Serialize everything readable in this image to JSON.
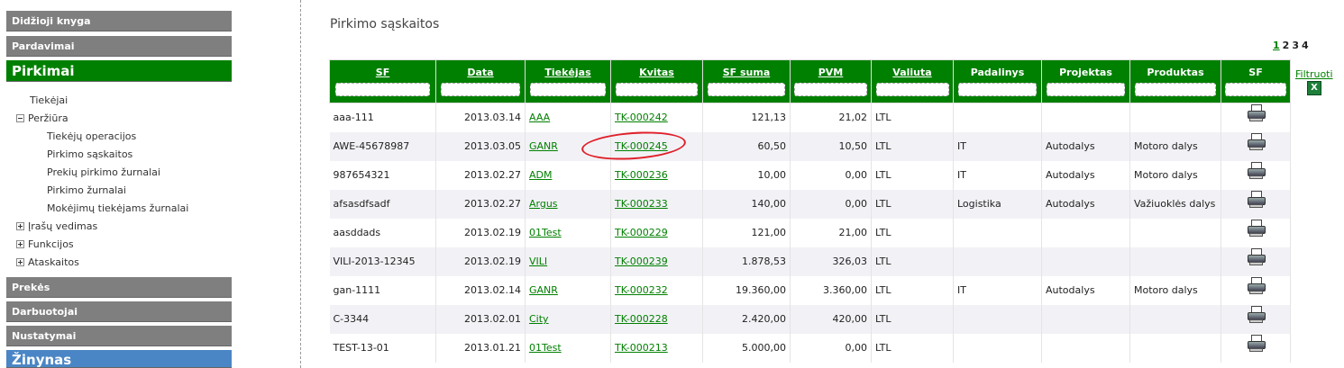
{
  "sidebar": {
    "menu": [
      {
        "label": "Didžioji knyga"
      },
      {
        "label": "Pardavimai"
      },
      {
        "label": "Pirkimai"
      },
      {
        "label": "Prekės"
      },
      {
        "label": "Darbuotojai"
      },
      {
        "label": "Nustatymai"
      },
      {
        "label": "Žinynas"
      }
    ],
    "tree": [
      {
        "label": "Tiekėjai"
      },
      {
        "label": "Peržiūra"
      },
      {
        "label": "Tiekėjų operacijos"
      },
      {
        "label": "Pirkimo sąskaitos"
      },
      {
        "label": "Prekių pirkimo žurnalai"
      },
      {
        "label": "Pirkimo žurnalai"
      },
      {
        "label": "Mokėjimų tiekėjams žurnalai"
      },
      {
        "label": "Įrašų vedimas"
      },
      {
        "label": "Funkcijos"
      },
      {
        "label": "Ataskaitos"
      }
    ]
  },
  "main": {
    "title": "Pirkimo sąskaitos",
    "pager": [
      "1",
      "2",
      "3",
      "4"
    ],
    "filter_link": "Filtruoti",
    "columns": [
      "SF",
      "Data",
      "Tiekėjas",
      "Kvitas",
      "SF suma",
      "PVM",
      "Valiuta",
      "Padalinys",
      "Projektas",
      "Produktas",
      "SF"
    ],
    "rows": [
      {
        "sf": "aaa-111",
        "data": "2013.03.14",
        "tiekejas": "AAA",
        "kvitas": "TK-000242",
        "suma": "121,13",
        "pvm": "21,02",
        "valiuta": "LTL",
        "padalinys": "",
        "projektas": "",
        "produktas": ""
      },
      {
        "sf": "AWE-45678987",
        "data": "2013.03.05",
        "tiekejas": "GANR",
        "kvitas": "TK-000245",
        "suma": "60,50",
        "pvm": "10,50",
        "valiuta": "LTL",
        "padalinys": "IT",
        "projektas": "Autodalys",
        "produktas": "Motoro dalys"
      },
      {
        "sf": "987654321",
        "data": "2013.02.27",
        "tiekejas": "ADM",
        "kvitas": "TK-000236",
        "suma": "10,00",
        "pvm": "0,00",
        "valiuta": "LTL",
        "padalinys": "IT",
        "projektas": "Autodalys",
        "produktas": "Motoro dalys"
      },
      {
        "sf": "afsasdfsadf",
        "data": "2013.02.27",
        "tiekejas": "Argus",
        "kvitas": "TK-000233",
        "suma": "140,00",
        "pvm": "0,00",
        "valiuta": "LTL",
        "padalinys": "Logistika",
        "projektas": "Autodalys",
        "produktas": "Važiuoklės dalys"
      },
      {
        "sf": "aasddads",
        "data": "2013.02.19",
        "tiekejas": "01Test",
        "kvitas": "TK-000229",
        "suma": "121,00",
        "pvm": "21,00",
        "valiuta": "LTL",
        "padalinys": "",
        "projektas": "",
        "produktas": ""
      },
      {
        "sf": "VILI-2013-12345",
        "data": "2013.02.19",
        "tiekejas": "VILI",
        "kvitas": "TK-000239",
        "suma": "1.878,53",
        "pvm": "326,03",
        "valiuta": "LTL",
        "padalinys": "",
        "projektas": "",
        "produktas": ""
      },
      {
        "sf": "gan-1111",
        "data": "2013.02.14",
        "tiekejas": "GANR",
        "kvitas": "TK-000232",
        "suma": "19.360,00",
        "pvm": "3.360,00",
        "valiuta": "LTL",
        "padalinys": "IT",
        "projektas": "Autodalys",
        "produktas": "Motoro dalys"
      },
      {
        "sf": "C-3344",
        "data": "2013.02.01",
        "tiekejas": "City",
        "kvitas": "TK-000228",
        "suma": "2.420,00",
        "pvm": "420,00",
        "valiuta": "LTL",
        "padalinys": "",
        "projektas": "",
        "produktas": ""
      },
      {
        "sf": "TEST-13-01",
        "data": "2013.01.21",
        "tiekejas": "01Test",
        "kvitas": "TK-000213",
        "suma": "5.000,00",
        "pvm": "0,00",
        "valiuta": "LTL",
        "padalinys": "",
        "projektas": "",
        "produktas": ""
      }
    ]
  },
  "icons": {
    "print": "printer-icon",
    "excel": "excel-icon",
    "expanded": "tree-minus-icon",
    "collapsed": "tree-plus-icon"
  },
  "colors": {
    "accent": "#008000",
    "menu": "#7f7f7f",
    "help": "#4a86c5",
    "annotation": "#e0202a"
  }
}
